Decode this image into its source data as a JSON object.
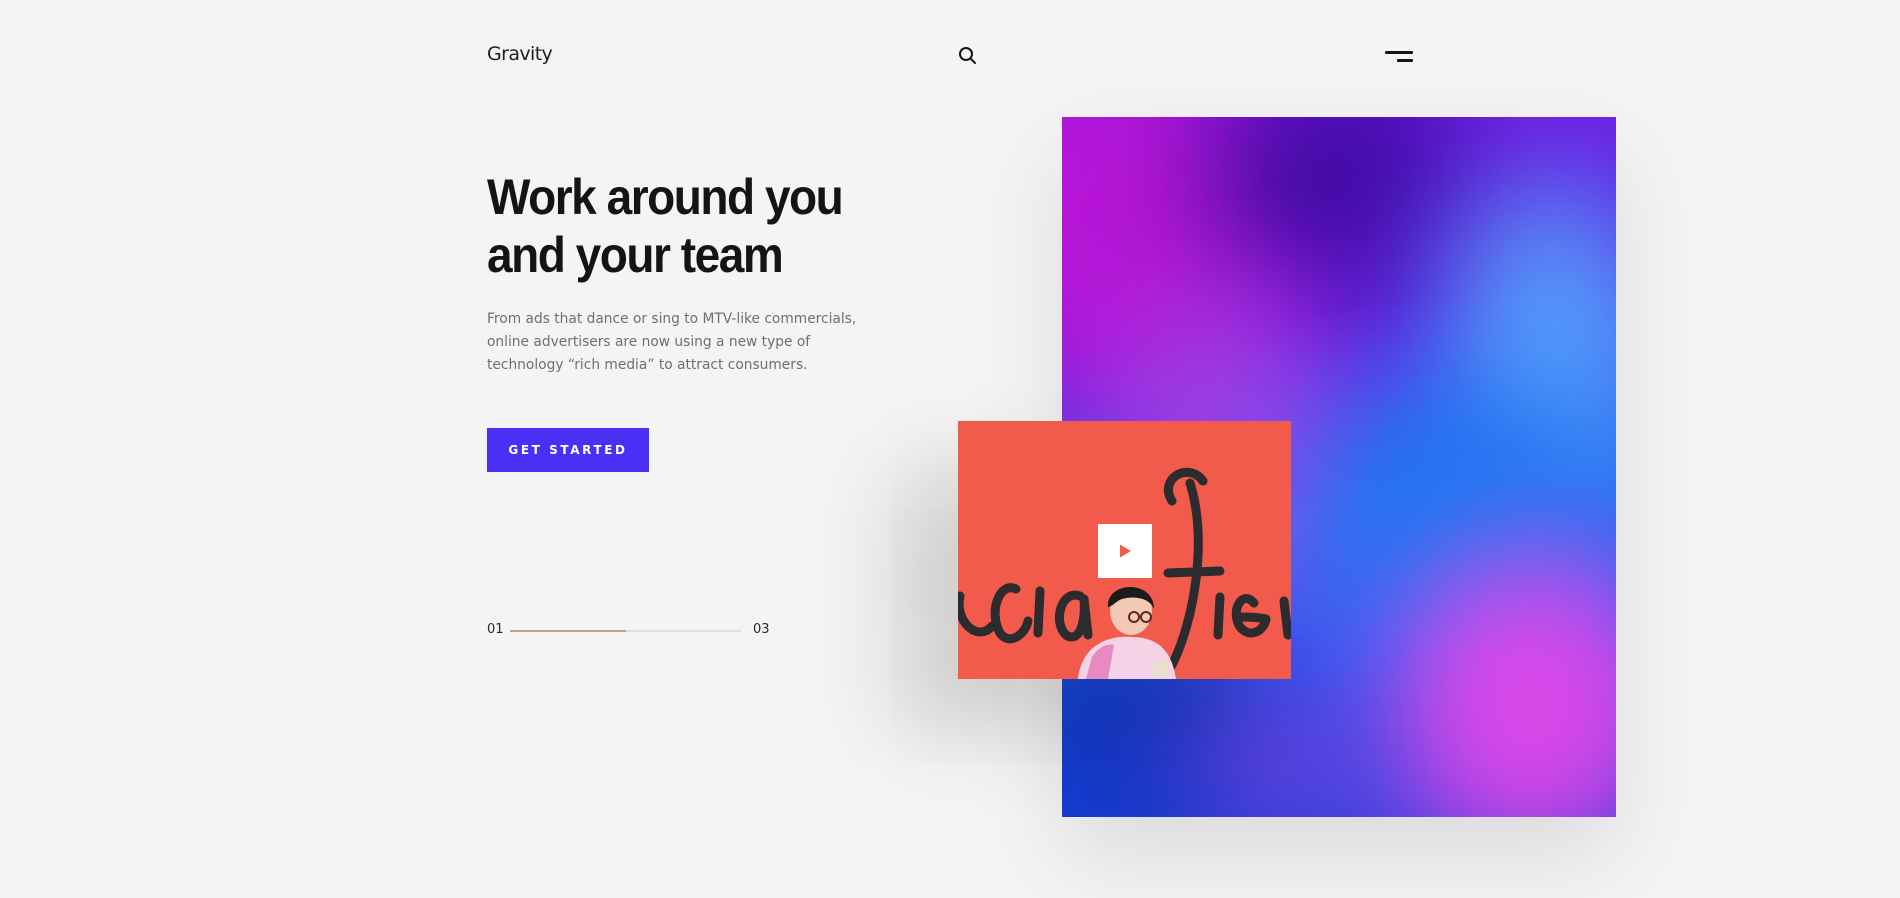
{
  "header": {
    "logo": "Gravity",
    "search_icon": "search-icon",
    "menu_icon": "menu-icon"
  },
  "hero": {
    "title_line1": "Work around you",
    "title_line2": "and your team",
    "description": "From ads that dance or sing to MTV-like commercials, online advertisers are now using a new type of technology “rich media” to attract consumers.",
    "cta_label": "GET STARTED"
  },
  "pager": {
    "current": "01",
    "total": "03",
    "progress": 0.5
  },
  "media": {
    "gradient_artwork": "abstract-gradient",
    "video_thumbnail": "person-mural-photo",
    "play_icon": "play-icon"
  },
  "colors": {
    "accent": "#4a2ff5",
    "progress_fill": "#c2a47e",
    "background": "#f4f4f4",
    "video_background": "#f25a4c"
  }
}
